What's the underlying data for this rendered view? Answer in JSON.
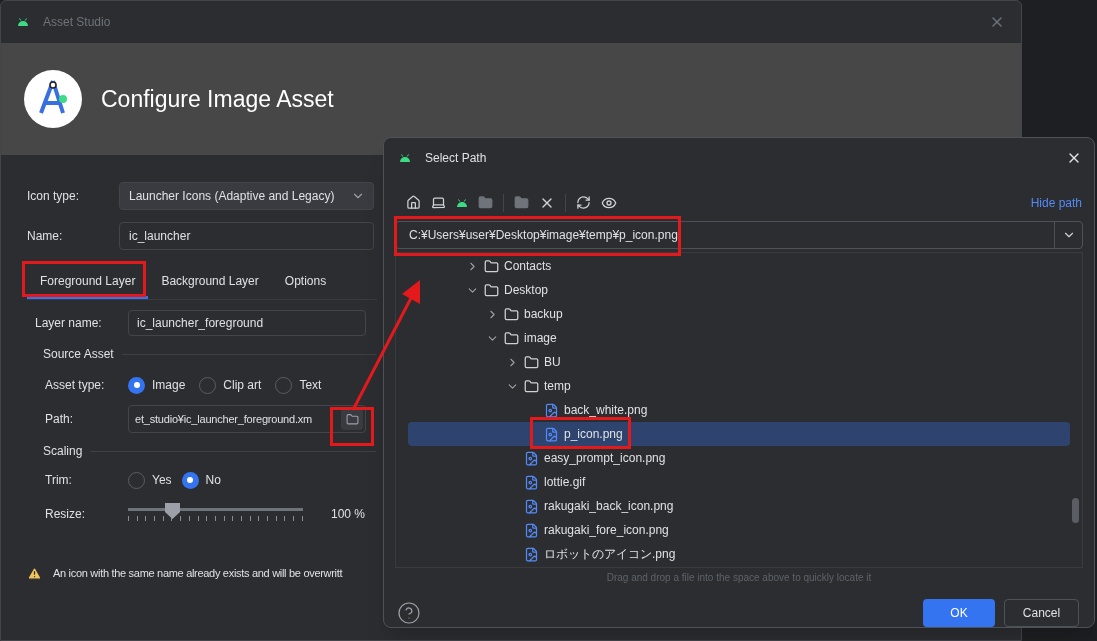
{
  "background_window": {
    "title": "Asset Studio",
    "heading": "Configure Image Asset",
    "icon_type": {
      "label": "Icon type:",
      "value": "Launcher Icons (Adaptive and Legacy)"
    },
    "name": {
      "label": "Name:",
      "value": "ic_launcher"
    },
    "tabs": [
      {
        "label": "Foreground Layer",
        "selected": true
      },
      {
        "label": "Background Layer",
        "selected": false
      },
      {
        "label": "Options",
        "selected": false
      }
    ],
    "layer_name": {
      "label": "Layer name:",
      "value": "ic_launcher_foreground"
    },
    "source_asset": {
      "title": "Source Asset",
      "asset_type": {
        "label": "Asset type:",
        "options": [
          {
            "label": "Image",
            "selected": true
          },
          {
            "label": "Clip art",
            "selected": false
          },
          {
            "label": "Text",
            "selected": false
          }
        ]
      },
      "path": {
        "label": "Path:",
        "value": "et_studio¥ic_launcher_foreground.xm"
      }
    },
    "scaling": {
      "title": "Scaling",
      "trim": {
        "label": "Trim:",
        "options": [
          {
            "label": "Yes",
            "selected": false
          },
          {
            "label": "No",
            "selected": true
          }
        ]
      },
      "resize": {
        "label": "Resize:",
        "level": 0.25,
        "reading": "100 %"
      }
    },
    "warning": "An icon with the same name already exists and will be overwritt"
  },
  "select_path_dialog": {
    "title": "Select Path",
    "hide_path_link": "Hide path",
    "path": "C:¥Users¥user¥Desktop¥image¥temp¥p_icon.png",
    "tree": [
      {
        "name": "Contacts",
        "kind": "folder",
        "expanded": false,
        "selected": false
      },
      {
        "name": "Desktop",
        "kind": "folder",
        "expanded": true,
        "selected": false,
        "children": [
          {
            "name": "backup",
            "kind": "folder",
            "expanded": false,
            "selected": false
          },
          {
            "name": "image",
            "kind": "folder",
            "expanded": true,
            "selected": false,
            "children": [
              {
                "name": "BU",
                "kind": "folder",
                "expanded": false,
                "selected": false
              },
              {
                "name": "temp",
                "kind": "folder",
                "expanded": true,
                "selected": false,
                "children": [
                  {
                    "name": "back_white.png",
                    "kind": "file",
                    "selected": false
                  },
                  {
                    "name": "p_icon.png",
                    "kind": "file",
                    "selected": true
                  }
                ]
              },
              {
                "name": "easy_prompt_icon.png",
                "kind": "file",
                "selected": false
              },
              {
                "name": "lottie.gif",
                "kind": "file",
                "selected": false
              },
              {
                "name": "rakugaki_back_icon.png",
                "kind": "file",
                "selected": false
              },
              {
                "name": "rakugaki_fore_icon.png",
                "kind": "file",
                "selected": false
              },
              {
                "name": "ロボットのアイコン.png",
                "kind": "file",
                "selected": false
              }
            ]
          }
        ]
      }
    ],
    "hint": "Drag and drop a file into the space above to quickly locate it",
    "buttons": [
      {
        "label": "OK",
        "kind": "primary"
      },
      {
        "label": "Cancel",
        "kind": "secondary"
      }
    ]
  }
}
